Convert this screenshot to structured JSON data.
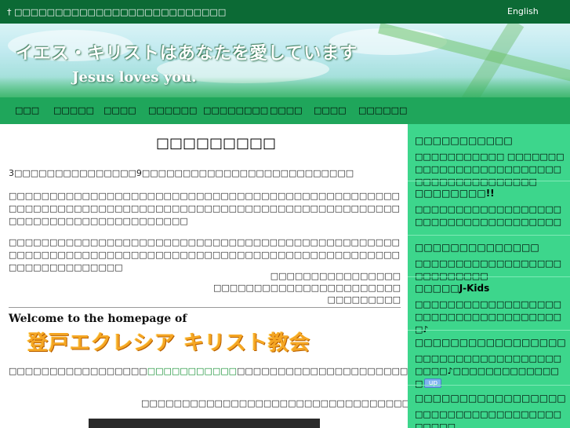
{
  "topbar": {
    "site_name": "† □□□□□□□□□□□□□□□□□□□□□□□□□□",
    "lang_link": "English"
  },
  "banner": {
    "jp_title": "イエス・キリストはあなたを愛しています",
    "en_title": "Jesus loves you."
  },
  "nav": {
    "items": [
      "□□□",
      "□□□□□",
      "□□□□",
      "□□□□□□",
      "□□□□□□□□",
      "□□□□",
      "□□□□",
      "□□□□□□"
    ]
  },
  "main": {
    "page_title": "□□□□□□□□□",
    "para1": "3□□□□□□□□□□□□□□□9□□□□□□□□□□□□□□□□□□□□□□□□□□",
    "para2": "□□□□□□□□□□□□□□□□□□□□□□□□□□□□□□□□□□□□□□□□□□□□□□□□□□□□□□□□□□□□□□□□□□□□□□□□□□□□□□□□□□□□□□□□□□□□□□□□□□□□□□□□□□□□□□□□□□□□□□",
    "para3": "□□□□□□□□□□□□□□□□□□□□□□□□□□□□□□□□□□□□□□□□□□□□□□□□□□□□□□□□□□□□□□□□□□□□□□□□□□□□□□□□□□□□□□□□□□□□□□□□□□□□□□□□□□□□□□",
    "signature": [
      "□□□□□□□□□□□□□□□□",
      "□□□□□□□□□□□□□□□□□□□□□□□",
      "□□□□□□□□□"
    ],
    "welcome_en": "Welcome to the homepage of",
    "welcome_jp": "登戸エクレシア キリスト教会",
    "intro_before": "□□□□□□□□□□□□□□□□□",
    "intro_link": "□□□□□□□□□□□",
    "intro_after": "□□□□□□□□□□□□□□□□□□□□□□□□□□□□□□□□□□□□□□□□□□",
    "caption": "□□□□□□□□□□□□□□□□□□□□□□□□□□□□□□□□□□□□□□□□□□□□□□□□□□□□□□□□□□□□□□□□|"
  },
  "sidebar": {
    "blocks": [
      {
        "heading": "□□□□□□□□□□□",
        "body": "□□□□□□□□□□□ □□□□□□□□□□□□□□□□□□□□□□□□□□□□□□□□□□□□□□□□"
      },
      {
        "heading": "□□□□□□□□!!",
        "body": "□□□□□□□□□□□□□□□□□□□□□□□□□□□□□□□□□□□□"
      },
      {
        "heading": "□□□□□□□□□□□□□□",
        "body": "□□□□□□□□□□□□□□□□□□□□□□□□□□□"
      },
      {
        "heading": "□□□□□J-Kids",
        "body": "□□□□□□□□□□□□□□□□□□□□□□□□□□□□□□□□□□□□□♪"
      },
      {
        "heading": "□□□□□□□□□□□□□□□□□",
        "body": "□□□□□□□□□□□□□□□□□□□□□□♪□□□□□□□□□□□□□□"
      },
      {
        "heading": "□□□□□□□□□□□□□□□□□",
        "body": "□□□□□□□□□□□□□□□□□□□□□□□"
      }
    ],
    "up_badge": "up"
  }
}
